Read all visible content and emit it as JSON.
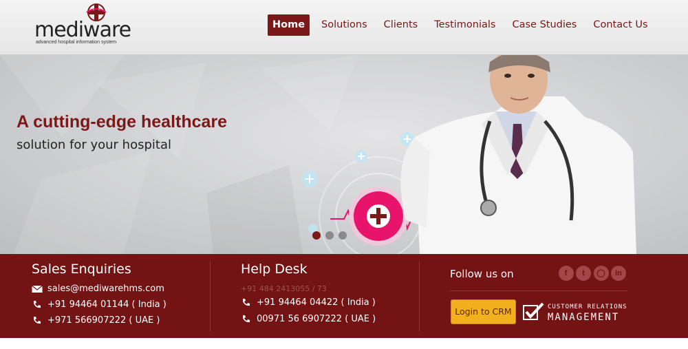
{
  "brand": {
    "name": "mediware",
    "tagline": "advanced hospital information system"
  },
  "nav": {
    "items": [
      {
        "label": "Home",
        "active": true
      },
      {
        "label": "Solutions",
        "active": false
      },
      {
        "label": "Clients",
        "active": false
      },
      {
        "label": "Testimonials",
        "active": false
      },
      {
        "label": "Case Studies",
        "active": false
      },
      {
        "label": "Contact Us",
        "active": false
      }
    ]
  },
  "hero": {
    "title": "A cutting-edge healthcare",
    "subtitle": "solution for your hospital",
    "slides": 3,
    "active_slide": 1
  },
  "sales": {
    "title": "Sales Enquiries",
    "email": "sales@mediwarehms.com",
    "phone_india": "+91 94464 01144 ( India )",
    "phone_uae": "+971 566907222 ( UAE )"
  },
  "helpdesk": {
    "title": "Help Desk",
    "landline": "+91 484 2413055 / 73",
    "phone_india": "+91 94464 04422 ( India )",
    "phone_uae": "00971 56 6907222 ( UAE )"
  },
  "social": {
    "title": "Follow us on",
    "icons": [
      "facebook-icon",
      "twitter-icon",
      "instagram-icon",
      "linkedin-icon"
    ]
  },
  "crm": {
    "button": "Login to CRM",
    "line1": "CUSTOMER RELATIONS",
    "line2": "MANAGEMENT"
  },
  "colors": {
    "brand_red": "#7b1818",
    "footer_bg": "#731314",
    "crm_button": "#f2b01e",
    "accent_pink": "#e8136b"
  }
}
